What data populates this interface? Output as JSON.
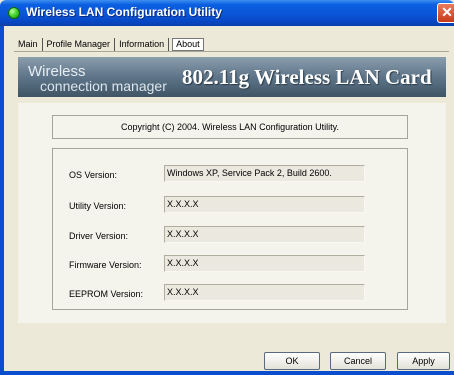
{
  "window": {
    "title": "Wireless LAN Configuration Utility",
    "close_glyph": "✕"
  },
  "tabs": [
    {
      "label": "Main",
      "active": false
    },
    {
      "label": "Profile Manager",
      "active": false
    },
    {
      "label": "Information",
      "active": false
    },
    {
      "label": "About",
      "active": true
    }
  ],
  "banner": {
    "left_line1": "Wireless",
    "left_line2": "connection manager",
    "right_text": "802.11g Wireless LAN Card"
  },
  "about": {
    "copyright": "Copyright (C) 2004.    Wireless LAN Configuration Utility.",
    "fields": [
      {
        "label": "OS Version:",
        "value": "Windows XP, Service Pack 2, Build 2600."
      },
      {
        "label": "Utility Version:",
        "value": "X.X.X.X"
      },
      {
        "label": "Driver Version:",
        "value": "X.X.X.X"
      },
      {
        "label": "Firmware Version:",
        "value": "X.X.X.X"
      },
      {
        "label": "EEPROM Version:",
        "value": "X.X.X.X"
      }
    ]
  },
  "buttons": {
    "ok": "OK",
    "cancel": "Cancel",
    "apply": "Apply"
  },
  "colors": {
    "titlebar": "#0a55d8",
    "close": "#c73a17",
    "window_bg": "#ece9d8"
  },
  "icons": {
    "title_icon": "green-orb-icon",
    "close_icon": "close-icon"
  }
}
